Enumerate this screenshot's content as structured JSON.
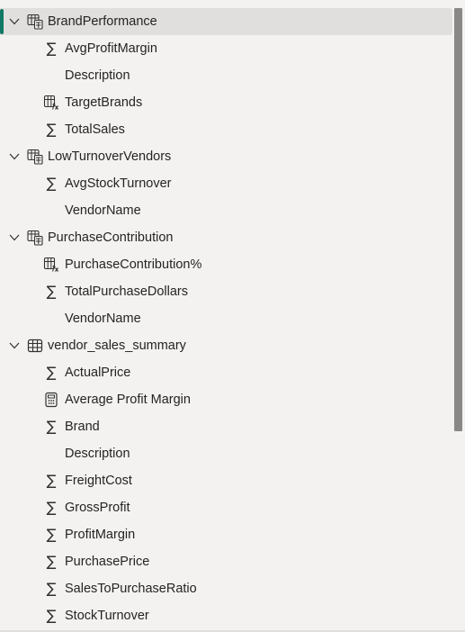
{
  "tables": [
    {
      "name": "BrandPerformance",
      "icon": "calculated-table-icon",
      "selected": true,
      "fields": [
        {
          "label": "AvgProfitMargin",
          "icon": "sigma-icon"
        },
        {
          "label": "Description",
          "icon": "none"
        },
        {
          "label": "TargetBrands",
          "icon": "calculated-column-icon"
        },
        {
          "label": "TotalSales",
          "icon": "sigma-icon"
        }
      ]
    },
    {
      "name": "LowTurnoverVendors",
      "icon": "calculated-table-icon",
      "selected": false,
      "fields": [
        {
          "label": "AvgStockTurnover",
          "icon": "sigma-icon"
        },
        {
          "label": "VendorName",
          "icon": "none"
        }
      ]
    },
    {
      "name": "PurchaseContribution",
      "icon": "calculated-table-icon",
      "selected": false,
      "fields": [
        {
          "label": "PurchaseContribution%",
          "icon": "calculated-column-icon"
        },
        {
          "label": "TotalPurchaseDollars",
          "icon": "sigma-icon"
        },
        {
          "label": "VendorName",
          "icon": "none"
        }
      ]
    },
    {
      "name": "vendor_sales_summary",
      "icon": "table-icon",
      "selected": false,
      "fields": [
        {
          "label": "ActualPrice",
          "icon": "sigma-icon"
        },
        {
          "label": "Average Profit Margin",
          "icon": "measure-calculator-icon"
        },
        {
          "label": "Brand",
          "icon": "sigma-icon"
        },
        {
          "label": "Description",
          "icon": "none"
        },
        {
          "label": "FreightCost",
          "icon": "sigma-icon"
        },
        {
          "label": "GrossProfit",
          "icon": "sigma-icon"
        },
        {
          "label": "ProfitMargin",
          "icon": "sigma-icon"
        },
        {
          "label": "PurchasePrice",
          "icon": "sigma-icon"
        },
        {
          "label": "SalesToPurchaseRatio",
          "icon": "sigma-icon"
        },
        {
          "label": "StockTurnover",
          "icon": "sigma-icon"
        }
      ]
    }
  ],
  "sigma_glyph": "∑",
  "colors": {
    "background": "#f3f2f1",
    "selected_row": "#e1dfdd",
    "selection_accent": "#117865",
    "text": "#252423",
    "scrollbar": "#8a8886"
  }
}
